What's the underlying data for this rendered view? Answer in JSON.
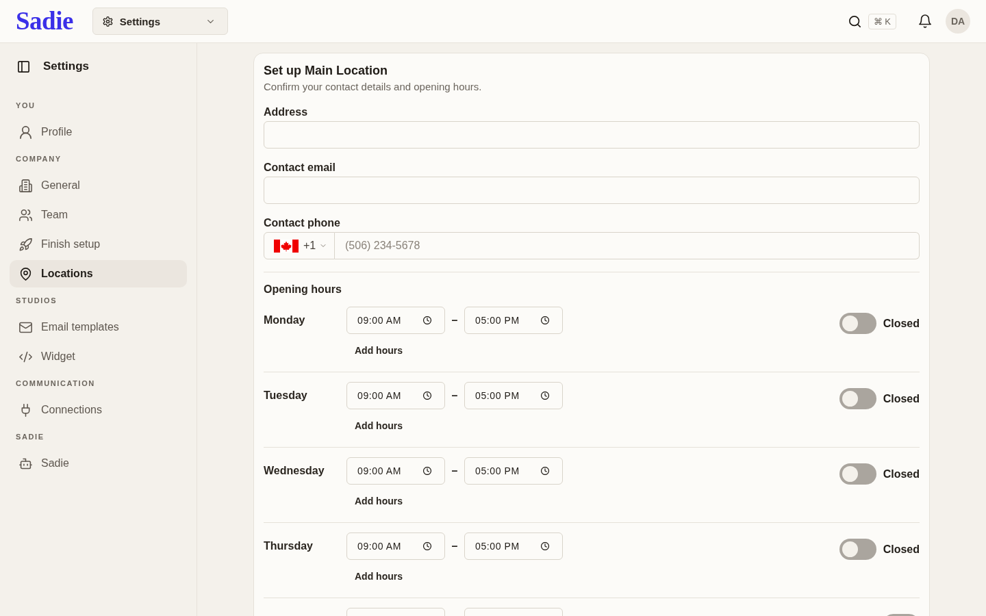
{
  "header": {
    "logo": "Sadie",
    "menu_label": "Settings",
    "shortcut": "⌘ K",
    "avatar": "DA"
  },
  "sidebar": {
    "title": "Settings",
    "sections": [
      {
        "label": "YOU",
        "items": [
          {
            "label": "Profile",
            "selected": false
          }
        ]
      },
      {
        "label": "COMPANY",
        "items": [
          {
            "label": "General",
            "selected": false
          },
          {
            "label": "Team",
            "selected": false
          },
          {
            "label": "Finish setup",
            "selected": false
          },
          {
            "label": "Locations",
            "selected": true
          }
        ]
      },
      {
        "label": "STUDIOS",
        "items": [
          {
            "label": "Email templates",
            "selected": false
          },
          {
            "label": "Widget",
            "selected": false
          }
        ]
      },
      {
        "label": "COMMUNICATION",
        "items": [
          {
            "label": "Connections",
            "selected": false
          }
        ]
      },
      {
        "label": "SADIE",
        "items": [
          {
            "label": "Sadie",
            "selected": false
          }
        ]
      }
    ]
  },
  "form": {
    "title": "Set up Main Location",
    "subtitle": "Confirm your contact details and opening hours.",
    "address": {
      "label": "Address"
    },
    "email": {
      "label": "Contact email"
    },
    "phone": {
      "label": "Contact phone",
      "country_code": "+1",
      "placeholder": "(506) 234-5678"
    },
    "hours": {
      "title": "Opening hours",
      "days": [
        {
          "kind": "day",
          "day": "Monday",
          "from": "09:00 AM",
          "separator": "–",
          "to": "05:00 PM",
          "add_label": "Add hours",
          "open": false,
          "status": "Closed"
        },
        {
          "kind": "day",
          "day": "Tuesday",
          "from": "09:00 AM",
          "separator": "–",
          "to": "05:00 PM",
          "add_label": "Add hours",
          "open": false,
          "status": "Closed"
        },
        {
          "kind": "day",
          "day": "Wednesday",
          "from": "09:00 AM",
          "separator": "–",
          "to": "05:00 PM",
          "add_label": "Add hours",
          "open": false,
          "status": "Closed"
        },
        {
          "kind": "day",
          "day": "Thursday",
          "from": "09:00 AM",
          "separator": "–",
          "to": "05:00 PM",
          "add_label": "Add hours",
          "open": false,
          "status": "Closed"
        },
        {
          "kind": "cut",
          "open": false
        }
      ]
    }
  }
}
